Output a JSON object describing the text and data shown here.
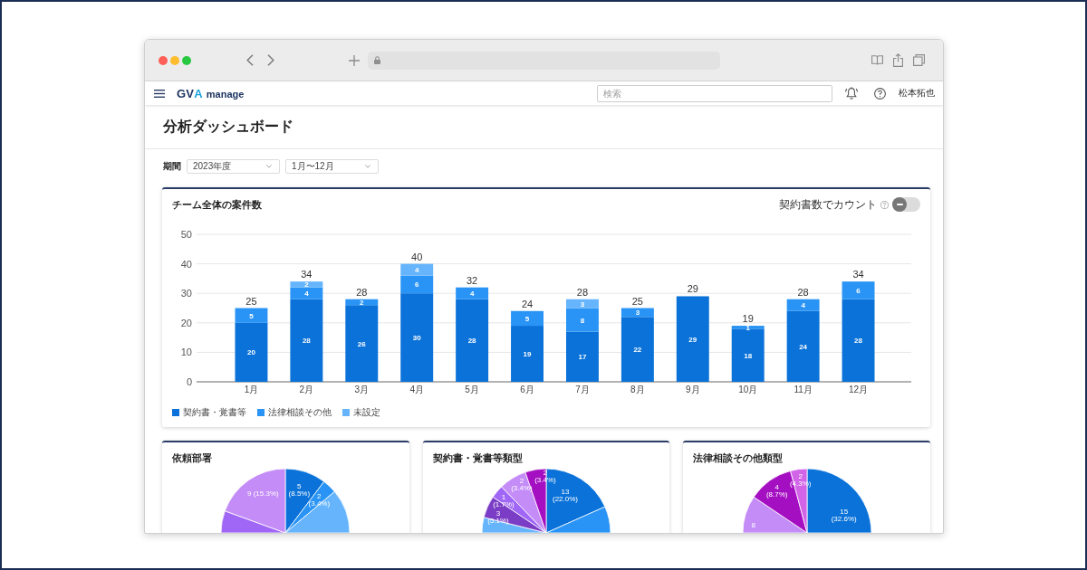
{
  "header": {
    "logo": {
      "mark": "GV",
      "accent": "A",
      "product": "manage"
    },
    "search": {
      "placeholder": "検索"
    },
    "user_name": "松本拓也"
  },
  "page": {
    "title": "分析ダッシュボード"
  },
  "filters": {
    "label": "期間",
    "selects": [
      {
        "value": "2023年度"
      },
      {
        "value": "1月〜12月"
      }
    ]
  },
  "team_chart": {
    "title": "チーム全体の案件数",
    "count_toggle": {
      "label": "契約書数でカウント",
      "on": false
    },
    "chart_data": {
      "type": "bar",
      "stacked": true,
      "grid": true,
      "categories": [
        "1月",
        "2月",
        "3月",
        "4月",
        "5月",
        "6月",
        "7月",
        "8月",
        "9月",
        "10月",
        "11月",
        "12月"
      ],
      "series": [
        {
          "name": "契約書・覚書等",
          "color": "#0a72d9",
          "values": [
            20,
            28,
            26,
            30,
            28,
            19,
            17,
            22,
            29,
            18,
            24,
            28
          ]
        },
        {
          "name": "法律相談その他",
          "color": "#2994f5",
          "values": [
            5,
            4,
            2,
            6,
            4,
            5,
            8,
            3,
            null,
            1,
            4,
            6
          ]
        },
        {
          "name": "未設定",
          "color": "#66b5fc",
          "values": [
            null,
            2,
            null,
            4,
            null,
            null,
            3,
            null,
            null,
            null,
            null,
            null
          ]
        }
      ],
      "ylim": [
        0,
        50
      ],
      "yticks": [
        0,
        10,
        20,
        30,
        40,
        50
      ],
      "data_labels": true,
      "annotations": [
        {
          "text": "25"
        },
        {
          "text": "34"
        },
        {
          "text": "28"
        },
        {
          "text": "40"
        },
        {
          "text": "32"
        },
        {
          "text": "24"
        },
        {
          "text": "28"
        },
        {
          "text": "25"
        },
        {
          "text": "29"
        },
        {
          "text": "19"
        },
        {
          "text": "28"
        },
        {
          "text": "34"
        }
      ]
    }
  },
  "breakdowns": [
    {
      "title": "依頼部署",
      "slices": [
        {
          "color": "#0a72d9",
          "label": "5 (8.5%)"
        },
        {
          "color": "#2994f5",
          "label": "2 (3.4%)"
        },
        {
          "color": "#66b5fc"
        },
        {
          "color": "#a066f5"
        },
        {
          "color": "#c48cf7",
          "label": "9 (15.3%)"
        }
      ]
    },
    {
      "title": "契約書・覚書等類型",
      "slices": [
        {
          "color": "#0a72d9",
          "label": "13 (22.0%)"
        },
        {
          "color": "#2994f5"
        },
        {
          "color": "#66b5fc"
        },
        {
          "color": "#7b3dc5",
          "label": "3 (5.1%)"
        },
        {
          "color": "#a066f5",
          "label": "1 (1.7%)"
        },
        {
          "color": "#c48cf7",
          "label": "2 (3.4%)"
        },
        {
          "color": "#a50fc2",
          "label": "2 (3.4%)"
        }
      ]
    },
    {
      "title": "法律相談その他類型",
      "slices": [
        {
          "color": "#0a72d9",
          "label": "15 (32.6%)"
        },
        {
          "color": "#c48cf7",
          "label": "8"
        },
        {
          "color": "#a50fc2",
          "label": "4 (8.7%)"
        },
        {
          "color": "#d264e8",
          "label": "2 (4.3%)"
        }
      ]
    }
  ]
}
